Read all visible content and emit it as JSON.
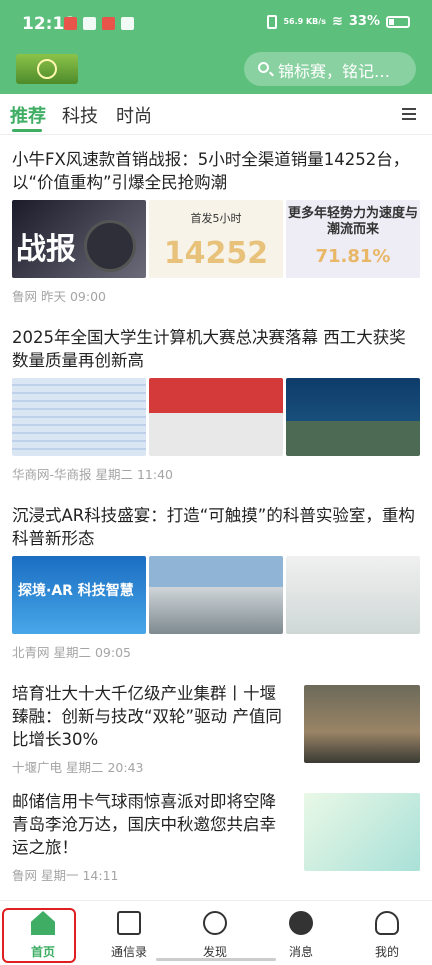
{
  "status_bar": {
    "time": "12:11",
    "net_speed": "56.9 KB/s",
    "battery": "33%"
  },
  "header": {
    "search_placeholder": "锦标赛，铭记…"
  },
  "tabs": [
    "推荐",
    "科技",
    "时尚"
  ],
  "articles": [
    {
      "title": "小牛FX风速款首销战报：5小时全渠道销量14252台，以“价值重构”引爆全民抢购潮",
      "source": "鲁网",
      "time": "昨天 09:00",
      "thumb1_text": "战报",
      "thumb2_label": "首发5小时",
      "thumb2_number": "14252",
      "thumb3_label": "更多年轻势力为速度与潮流而来",
      "thumb3_number": "71.81%"
    },
    {
      "title": "2025年全国大学生计算机大赛总决赛落幕 西工大获奖数量质量再创新高",
      "source": "华商网-华商报",
      "time": "星期二 11:40"
    },
    {
      "title": "沉浸式AR科技盛宴：打造“可触摸”的科普实验室，重构科普新形态",
      "source": "北青网",
      "time": "星期二 09:05",
      "thumb1_text": "探境·AR 科技智慧"
    },
    {
      "title": "培育壮大十大千亿级产业集群丨十堰臻融：创新与技改“双轮”驱动 产值同比增长30%",
      "source": "十堰广电",
      "time": "星期二 20:43"
    },
    {
      "title": "邮储信用卡气球雨惊喜派对即将空降青岛李沧万达，国庆中秋邀您共启幸运之旅！",
      "source": "鲁网",
      "time": "星期一 14:11"
    }
  ],
  "nav": [
    {
      "label": "首页",
      "icon": "home-icon"
    },
    {
      "label": "通信录",
      "icon": "contacts-icon"
    },
    {
      "label": "发现",
      "icon": "compass-icon"
    },
    {
      "label": "消息",
      "icon": "message-icon"
    },
    {
      "label": "我的",
      "icon": "person-icon"
    }
  ],
  "colors": {
    "brand_green": "#5cbf7c",
    "active_green": "#3fae64",
    "highlight_red": "#e02020"
  }
}
